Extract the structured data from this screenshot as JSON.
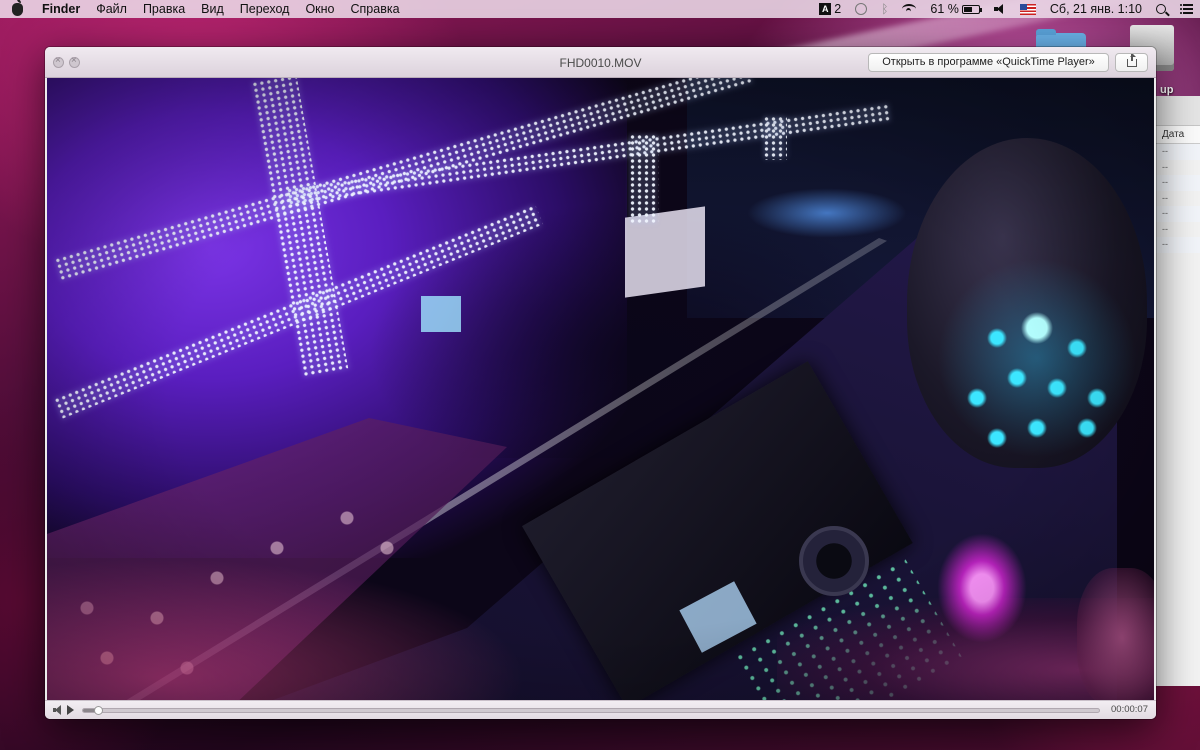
{
  "menubar": {
    "app_name": "Finder",
    "items": [
      "Файл",
      "Правка",
      "Вид",
      "Переход",
      "Окно",
      "Справка"
    ],
    "status": {
      "adobe_count": "2",
      "battery_percent": "61 %",
      "battery_level": 0.61,
      "datetime": "Сб, 21 янв.  1:10"
    },
    "icons": [
      "apple-icon",
      "adobe-icon",
      "time-machine-icon",
      "bluetooth-icon",
      "wifi-icon",
      "battery-icon",
      "volume-icon",
      "us-flag-icon",
      "search-icon",
      "notification-list-icon"
    ]
  },
  "desktop": {
    "drive_label_partial": "up",
    "finder_column_header": "Дата",
    "finder_rows": [
      "--",
      "--",
      "--",
      "--",
      "--",
      "--",
      "--"
    ]
  },
  "window": {
    "title": "FHD0010.MOV",
    "open_in_button": "Открыть в программе «QuickTime Player»",
    "share_icon": "share-icon",
    "controls": {
      "time_remaining": "00:00:07",
      "playback_progress": 0.015
    }
  },
  "colors": {
    "video_purple": "#7b34e6",
    "dj_led_cyan": "#3ce6ff",
    "glove_pink": "#e628e6"
  }
}
